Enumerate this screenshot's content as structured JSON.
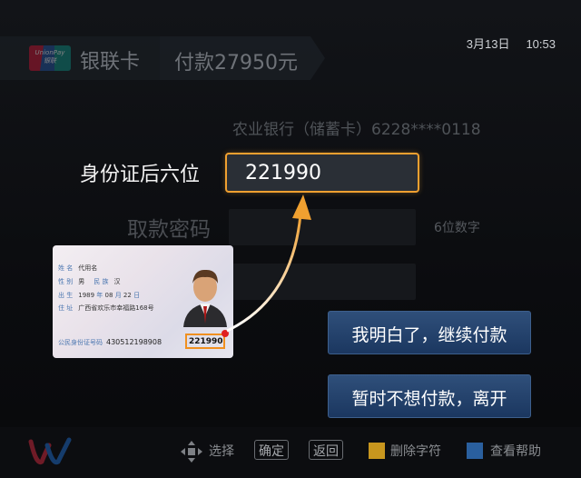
{
  "header": {
    "unionpay_text": "UnionPay 银联",
    "card_tab": "银联卡",
    "pay_tab": "付款27950元",
    "date": "3月13日",
    "time": "10:53"
  },
  "form": {
    "bank_line": "农业银行（储蓄卡）6228****0118",
    "id_label": "身份证后六位",
    "id_value": "221990",
    "pwd_label": "取款密码",
    "pwd_hint": "6位数字"
  },
  "idcard": {
    "name_key": "姓 名",
    "name_val": "代用名",
    "sex_key": "性 别",
    "sex_val": "男",
    "nation_key": "民 族",
    "nation_val": "汉",
    "birth_key": "出 生",
    "birth_year": "1989",
    "birth_year_unit": "年",
    "birth_month": "08",
    "birth_month_unit": "月",
    "birth_day": "22",
    "birth_day_unit": "日",
    "addr_key": "住 址",
    "addr_val": "广西省欢乐市幸福路168号",
    "number_key": "公民身份证号码",
    "number_prefix": "430512198908",
    "number_last6": "221990"
  },
  "actions": {
    "continue": "我明白了，继续付款",
    "leave": "暂时不想付款，离开"
  },
  "footer": {
    "select": "选择",
    "confirm": "确定",
    "back": "返回",
    "delete": "删除字符",
    "help": "查看帮助",
    "delete_color": "#c8961e",
    "help_color": "#2a5f9e"
  },
  "colors": {
    "accent": "#f0a030",
    "button": "#1b3760"
  }
}
